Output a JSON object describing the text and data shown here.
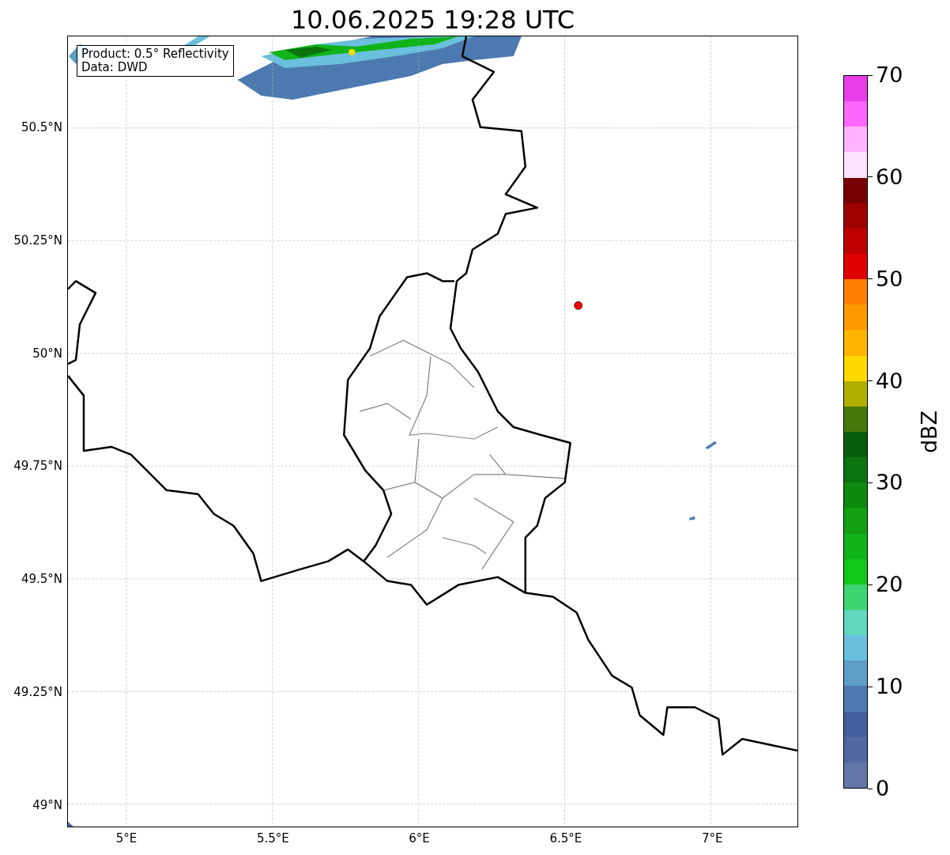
{
  "title": "10.06.2025 19:28 UTC",
  "map": {
    "info_box": [
      "Product: 0.5° Reflectivity",
      "Data: DWD"
    ],
    "y_ticks": [
      "50.5°N",
      "50.25°N",
      "50°N",
      "49.75°N",
      "49.5°N",
      "49.25°N",
      "49°N"
    ],
    "x_ticks": [
      "5°E",
      "5.5°E",
      "6°E",
      "6.5°E",
      "7°E"
    ]
  },
  "colorbar": {
    "label": "dBZ",
    "ticks": [
      "70",
      "60",
      "50",
      "40",
      "30",
      "20",
      "10",
      "0"
    ],
    "bins": [
      {
        "color": "#6476a8"
      },
      {
        "color": "#5268a0"
      },
      {
        "color": "#4460a0"
      },
      {
        "color": "#4c7ab0"
      },
      {
        "color": "#5c9ec6"
      },
      {
        "color": "#6ac0dc"
      },
      {
        "color": "#60d8c0"
      },
      {
        "color": "#3cd670"
      },
      {
        "color": "#10c81a"
      },
      {
        "color": "#10b418"
      },
      {
        "color": "#10a010"
      },
      {
        "color": "#0d890f"
      },
      {
        "color": "#0b740f"
      },
      {
        "color": "#065e0b"
      },
      {
        "color": "#457a0a"
      },
      {
        "color": "#b0b000"
      },
      {
        "color": "#ffd800"
      },
      {
        "color": "#ffb400"
      },
      {
        "color": "#ff9900"
      },
      {
        "color": "#ff7f00"
      },
      {
        "color": "#e00000"
      },
      {
        "color": "#c00000"
      },
      {
        "color": "#a00000"
      },
      {
        "color": "#780000"
      },
      {
        "color": "#ffe0ff"
      },
      {
        "color": "#ffb3ff"
      },
      {
        "color": "#ff66ff"
      },
      {
        "color": "#e93de9"
      }
    ]
  }
}
